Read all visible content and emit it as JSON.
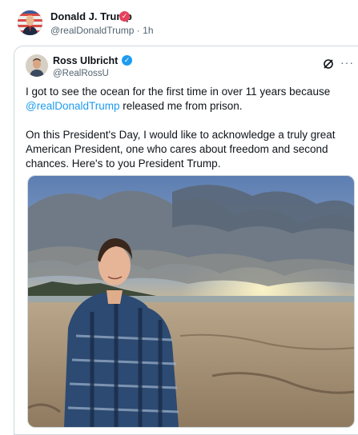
{
  "outer_post": {
    "author_name": "Donald J. Trump",
    "handle": "@realDonaldTrump",
    "separator": "·",
    "time": "1h",
    "verified_color": "#e7405f",
    "avatar_icon": "flag-avatar"
  },
  "quoted_post": {
    "author_name": "Ross Ulbricht",
    "handle": "@RealRossU",
    "verified_color": "#1d9bf0",
    "more_icon": "more-icon",
    "grok_icon": "grok-icon",
    "text_line1_pre": "I got to see the ocean for the first time in over 11 years because",
    "mention": "@realDonaldTrump",
    "text_line2_post": " released me from prison.",
    "text_para2": "On this President's Day, I would like to acknowledge a truly great American President, one who cares about freedom and second chances. Here's to you President Trump.",
    "photo_alt": "beach-sunset-photo"
  }
}
